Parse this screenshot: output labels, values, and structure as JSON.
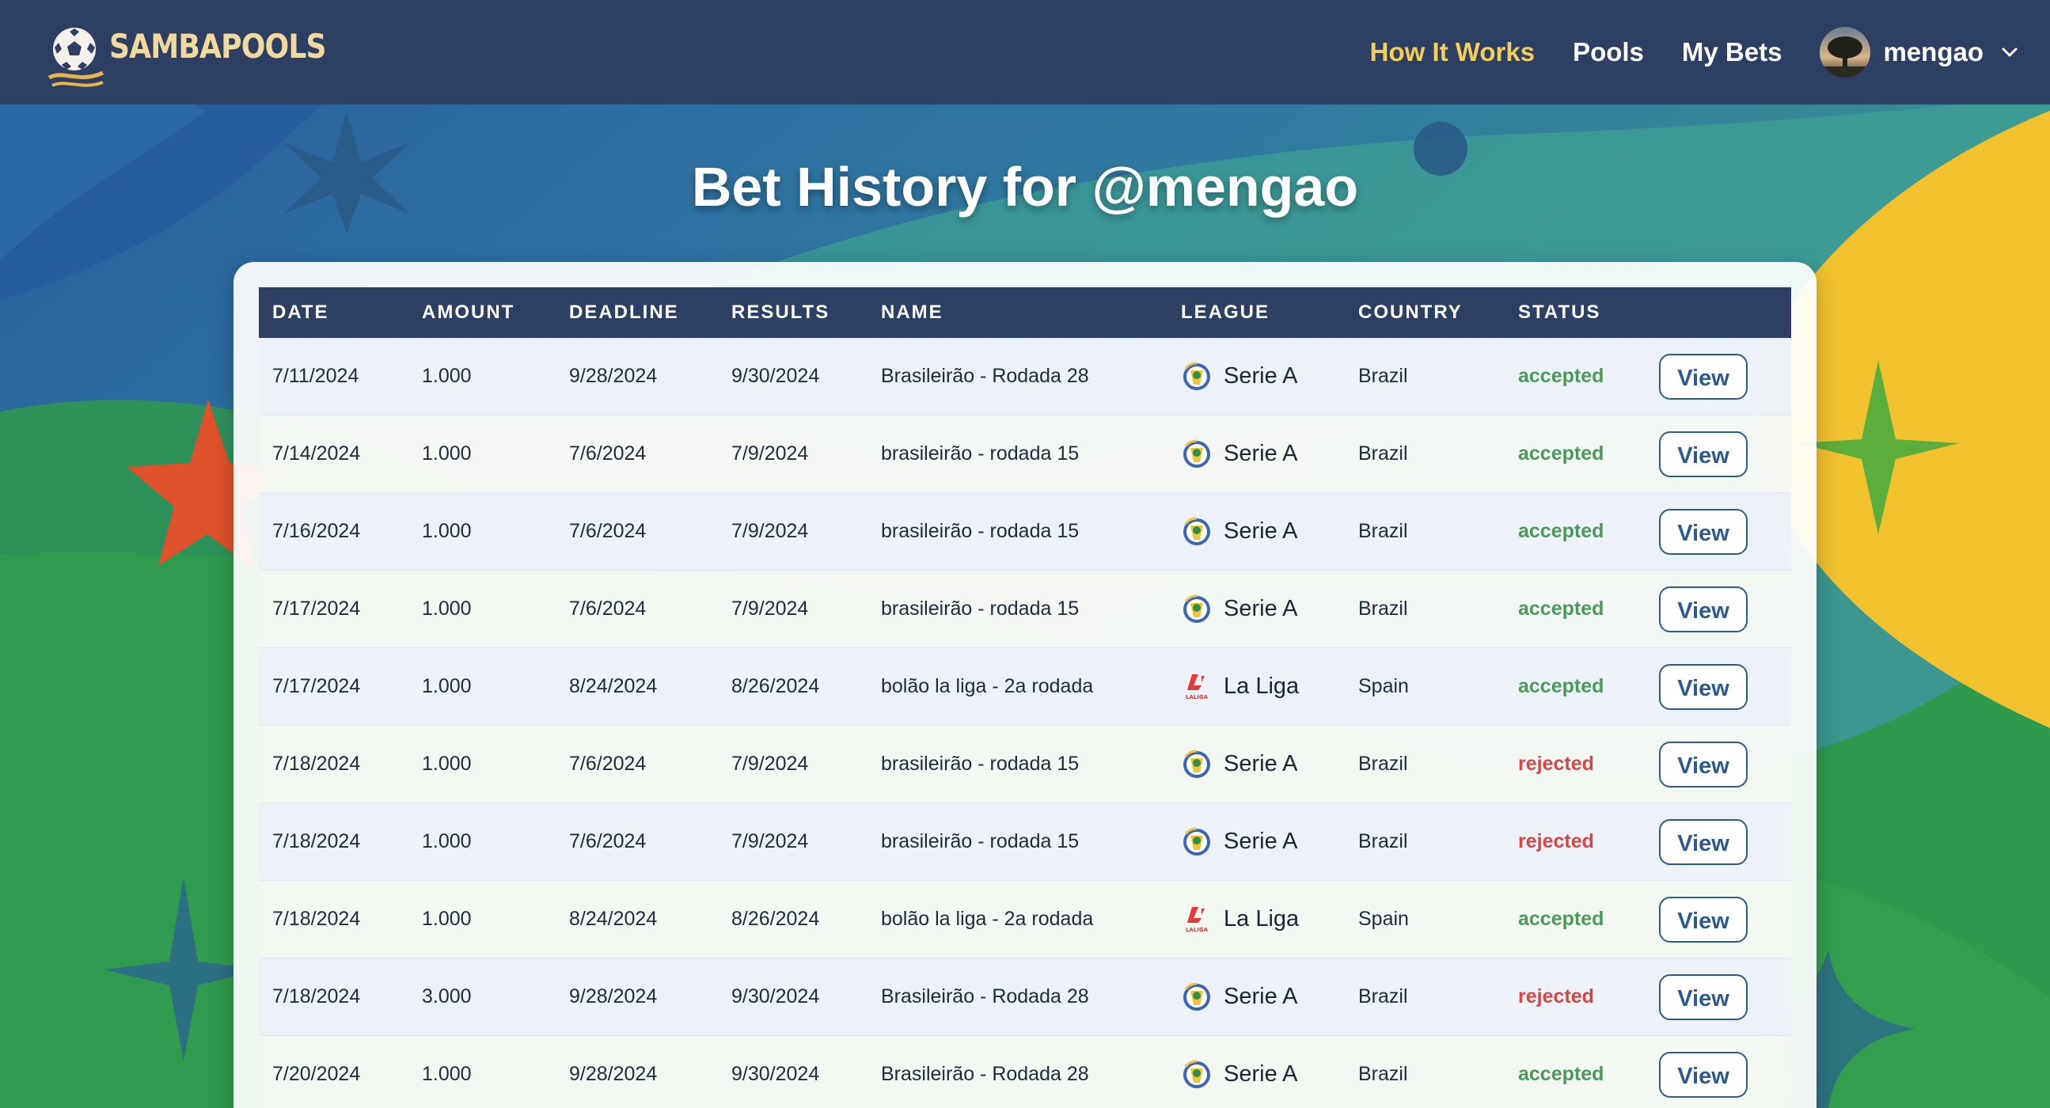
{
  "brand": {
    "name": "SAMBAPOOLS"
  },
  "nav": {
    "links": [
      {
        "label": "How It Works",
        "active": true
      },
      {
        "label": "Pools",
        "active": false
      },
      {
        "label": "My Bets",
        "active": false
      }
    ],
    "user": {
      "name": "mengao"
    }
  },
  "page": {
    "title": "Bet History for @mengao"
  },
  "table": {
    "headers": {
      "date": "DATE",
      "amount": "AMOUNT",
      "deadline": "DEADLINE",
      "results": "RESULTS",
      "name": "NAME",
      "league": "LEAGUE",
      "country": "COUNTRY",
      "status": "STATUS",
      "action": ""
    },
    "rows": [
      {
        "date": "7/11/2024",
        "amount": "1.000",
        "deadline": "9/28/2024",
        "results": "9/30/2024",
        "name": "Brasileirão - Rodada 28",
        "league": "Serie A",
        "league_icon": "serie-a-logo-icon",
        "country": "Brazil",
        "status": "accepted",
        "action": "View"
      },
      {
        "date": "7/14/2024",
        "amount": "1.000",
        "deadline": "7/6/2024",
        "results": "7/9/2024",
        "name": "brasileirão - rodada 15",
        "league": "Serie A",
        "league_icon": "serie-a-logo-icon",
        "country": "Brazil",
        "status": "accepted",
        "action": "View"
      },
      {
        "date": "7/16/2024",
        "amount": "1.000",
        "deadline": "7/6/2024",
        "results": "7/9/2024",
        "name": "brasileirão - rodada 15",
        "league": "Serie A",
        "league_icon": "serie-a-logo-icon",
        "country": "Brazil",
        "status": "accepted",
        "action": "View"
      },
      {
        "date": "7/17/2024",
        "amount": "1.000",
        "deadline": "7/6/2024",
        "results": "7/9/2024",
        "name": "brasileirão - rodada 15",
        "league": "Serie A",
        "league_icon": "serie-a-logo-icon",
        "country": "Brazil",
        "status": "accepted",
        "action": "View"
      },
      {
        "date": "7/17/2024",
        "amount": "1.000",
        "deadline": "8/24/2024",
        "results": "8/26/2024",
        "name": "bolão la liga - 2a rodada",
        "league": "La Liga",
        "league_icon": "laliga-logo-icon",
        "country": "Spain",
        "status": "accepted",
        "action": "View"
      },
      {
        "date": "7/18/2024",
        "amount": "1.000",
        "deadline": "7/6/2024",
        "results": "7/9/2024",
        "name": "brasileirão - rodada 15",
        "league": "Serie A",
        "league_icon": "serie-a-logo-icon",
        "country": "Brazil",
        "status": "rejected",
        "action": "View"
      },
      {
        "date": "7/18/2024",
        "amount": "1.000",
        "deadline": "7/6/2024",
        "results": "7/9/2024",
        "name": "brasileirão - rodada 15",
        "league": "Serie A",
        "league_icon": "serie-a-logo-icon",
        "country": "Brazil",
        "status": "rejected",
        "action": "View"
      },
      {
        "date": "7/18/2024",
        "amount": "1.000",
        "deadline": "8/24/2024",
        "results": "8/26/2024",
        "name": "bolão la liga - 2a rodada",
        "league": "La Liga",
        "league_icon": "laliga-logo-icon",
        "country": "Spain",
        "status": "accepted",
        "action": "View"
      },
      {
        "date": "7/18/2024",
        "amount": "3.000",
        "deadline": "9/28/2024",
        "results": "9/30/2024",
        "name": "Brasileirão - Rodada 28",
        "league": "Serie A",
        "league_icon": "serie-a-logo-icon",
        "country": "Brazil",
        "status": "rejected",
        "action": "View"
      },
      {
        "date": "7/20/2024",
        "amount": "1.000",
        "deadline": "9/28/2024",
        "results": "9/30/2024",
        "name": "Brasileirão - Rodada 28",
        "league": "Serie A",
        "league_icon": "serie-a-logo-icon",
        "country": "Brazil",
        "status": "accepted",
        "action": "View"
      }
    ]
  },
  "colors": {
    "navbar": "#2d4063",
    "nav_active": "#f2cf5a",
    "accepted": "#4a9a5a",
    "rejected": "#d24848",
    "button_border": "#2d5a8e"
  }
}
